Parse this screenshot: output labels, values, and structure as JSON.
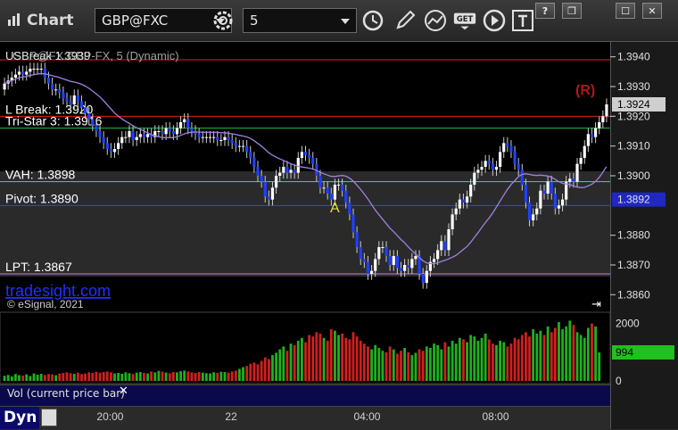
{
  "app": {
    "title": "Chart",
    "symbol": "GBP@FXC",
    "interval": "5"
  },
  "window_controls": [
    "?",
    "❐",
    "☐",
    "✕"
  ],
  "toolbar_icons": [
    "gear-icon",
    "clock-icon",
    "pencil-icon",
    "line-study-icon",
    "get-icon",
    "play-icon",
    "text-icon"
  ],
  "legend": {
    "series_label": "GBP@FX:GBP-FX, 5 (Dynamic)",
    "overlay_label": "USBreak 1.3939"
  },
  "levels": [
    {
      "name": "L Break",
      "label": "L Break: 1.3920",
      "value": 1.392,
      "color": "#e02020"
    },
    {
      "name": "Tri-Star 3",
      "label": "Tri-Star 3: 1.3916",
      "value": 1.3916,
      "color": "#20c040"
    },
    {
      "name": "VAH",
      "label": "VAH: 1.3898",
      "value": 1.3898,
      "color": "#20e0c0"
    },
    {
      "name": "Pivot",
      "label": "Pivot: 1.3890",
      "value": 1.389,
      "color": "#4040e0"
    },
    {
      "name": "LPT",
      "label": "LPT: 1.3867",
      "value": 1.3867,
      "color": "#c080e0"
    },
    {
      "name": "Top",
      "label": "",
      "value": 1.3939,
      "color": "#e02020"
    }
  ],
  "annotations": {
    "r_marker": "(R)",
    "a_marker": "A",
    "watermark": "tradesight.com",
    "copyright": "© eSignal, 2021"
  },
  "price_axis": {
    "ticks": [
      "1.3940",
      "1.3930",
      "1.3920",
      "1.3910",
      "1.3900",
      "1.3880",
      "1.3870",
      "1.3860"
    ],
    "current_price": "1.3924",
    "pivot_price": "1.3892"
  },
  "volume_axis": {
    "ticks": [
      "2000",
      "1000",
      "0"
    ],
    "current_volume": "994"
  },
  "status": {
    "label": "Vol (current price bar)",
    "close": "✕",
    "mode": "Dyn"
  },
  "time_axis": {
    "labels": [
      "20:00",
      "22",
      "04:00",
      "08:00"
    ]
  },
  "chart_data": {
    "type": "candlestick",
    "ylim": [
      1.3855,
      1.3945
    ],
    "vol_ylim": [
      0,
      2300
    ],
    "colors": {
      "up": "#ffffff",
      "down": "#2040ff",
      "vol_up": "#20b020",
      "vol_down": "#d02020",
      "ma": "#a080e0"
    },
    "time_labels": [
      {
        "label": "20:00",
        "index": 29
      },
      {
        "label": "22",
        "index": 64
      },
      {
        "label": "04:00",
        "index": 99
      },
      {
        "label": "08:00",
        "index": 134
      }
    ],
    "close": [
      1.3931,
      1.3932,
      1.3933,
      1.3934,
      1.3935,
      1.3934,
      1.3935,
      1.3936,
      1.3936,
      1.3936,
      1.3936,
      1.3933,
      1.3931,
      1.3929,
      1.3929,
      1.3928,
      1.3926,
      1.3925,
      1.3924,
      1.3927,
      1.3925,
      1.3923,
      1.3921,
      1.3919,
      1.3917,
      1.3915,
      1.3913,
      1.3911,
      1.3909,
      1.3908,
      1.3909,
      1.3911,
      1.3913,
      1.3913,
      1.3915,
      1.3912,
      1.3913,
      1.3914,
      1.3913,
      1.3914,
      1.3913,
      1.3915,
      1.3915,
      1.3914,
      1.3916,
      1.3915,
      1.3914,
      1.3916,
      1.3918,
      1.3919,
      1.3916,
      1.3915,
      1.3914,
      1.3913,
      1.3913,
      1.3913,
      1.3913,
      1.3913,
      1.3912,
      1.3912,
      1.3913,
      1.3912,
      1.3911,
      1.391,
      1.391,
      1.391,
      1.3908,
      1.3906,
      1.3903,
      1.39,
      1.3898,
      1.3893,
      1.3892,
      1.3896,
      1.39,
      1.3901,
      1.3903,
      1.3901,
      1.3902,
      1.3901,
      1.3906,
      1.3908,
      1.3907,
      1.3906,
      1.3904,
      1.39,
      1.3896,
      1.3896,
      1.3894,
      1.3892,
      1.3897,
      1.3897,
      1.3895,
      1.3891,
      1.3887,
      1.3881,
      1.3876,
      1.3872,
      1.3871,
      1.3867,
      1.3868,
      1.3872,
      1.3876,
      1.3876,
      1.3873,
      1.387,
      1.3873,
      1.3869,
      1.3868,
      1.387,
      1.3869,
      1.3872,
      1.3873,
      1.3867,
      1.3864,
      1.3868,
      1.3871,
      1.3872,
      1.3875,
      1.3878,
      1.3875,
      1.3882,
      1.3887,
      1.3889,
      1.3892,
      1.3891,
      1.3893,
      1.3897,
      1.3901,
      1.3902,
      1.3903,
      1.3905,
      1.3904,
      1.3902,
      1.3903,
      1.3908,
      1.3911,
      1.391,
      1.3908,
      1.3904,
      1.3902,
      1.3897,
      1.3891,
      1.3885,
      1.3887,
      1.3889,
      1.3895,
      1.3894,
      1.3898,
      1.3894,
      1.3889,
      1.389,
      1.3892,
      1.3898,
      1.3899,
      1.3898,
      1.3904,
      1.3906,
      1.391,
      1.3914,
      1.3913,
      1.3916,
      1.3918,
      1.392,
      1.3924
    ],
    "volume": [
      180,
      210,
      160,
      240,
      200,
      190,
      230,
      170,
      260,
      220,
      250,
      210,
      240,
      230,
      200,
      260,
      280,
      300,
      270,
      250,
      290,
      240,
      260,
      300,
      280,
      320,
      290,
      310,
      330,
      300,
      260,
      280,
      250,
      300,
      270,
      240,
      290,
      310,
      280,
      260,
      330,
      300,
      350,
      320,
      290,
      270,
      310,
      300,
      340,
      360,
      330,
      300,
      280,
      310,
      290,
      270,
      260,
      300,
      280,
      320,
      310,
      290,
      330,
      360,
      420,
      480,
      520,
      600,
      640,
      580,
      700,
      820,
      760,
      900,
      980,
      1100,
      1200,
      1050,
      1300,
      1250,
      1400,
      1500,
      1350,
      1600,
      1550,
      1700,
      1650,
      1500,
      1400,
      1800,
      1750,
      1600,
      1650,
      1500,
      1450,
      1700,
      1550,
      1400,
      1300,
      1200,
      1100,
      1250,
      1150,
      1050,
      1000,
      1200,
      1100,
      950,
      1050,
      1150,
      1000,
      900,
      980,
      1100,
      1050,
      1200,
      1150,
      1300,
      1250,
      1100,
      1350,
      1200,
      1400,
      1300,
      1500,
      1450,
      1350,
      1600,
      1550,
      1400,
      1500,
      1650,
      1450,
      1300,
      1250,
      1400,
      1350,
      1200,
      1300,
      1500,
      1450,
      1600,
      1700,
      1550,
      1800,
      1650,
      1750,
      1600,
      1900,
      1700,
      1850,
      2050,
      1800,
      1900,
      2100,
      1950,
      1700,
      1600,
      1500,
      1850,
      2000,
      1900,
      994
    ]
  }
}
